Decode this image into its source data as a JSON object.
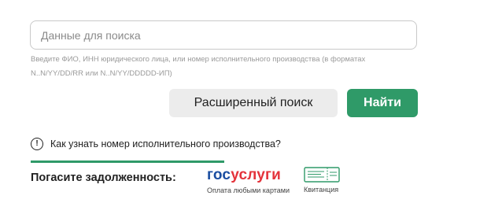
{
  "search": {
    "placeholder": "Данные для поиска",
    "value": "",
    "hint": "Введите ФИО, ИНН юридического лица, или номер исполнительного производства (в форматах N..N/YY/DD/RR или N..N/YY/DDDDD-ИП)"
  },
  "buttons": {
    "advanced_search": "Расширенный поиск",
    "find": "Найти"
  },
  "help": {
    "icon": "exclamation-circle-icon",
    "glyph": "!",
    "link_text": "Как узнать номер исполнительного производства?"
  },
  "payment": {
    "label": "Погасите задолженность:",
    "gosuslugi": {
      "logo_part1": "гос",
      "logo_part2": "услуги",
      "caption": "Оплата любыми картами"
    },
    "receipt": {
      "icon": "receipt-icon",
      "caption": "Квитанция"
    }
  },
  "colors": {
    "accent_green": "#2f9a68",
    "gos_blue": "#1b4ea1",
    "gos_red": "#e4333b"
  }
}
